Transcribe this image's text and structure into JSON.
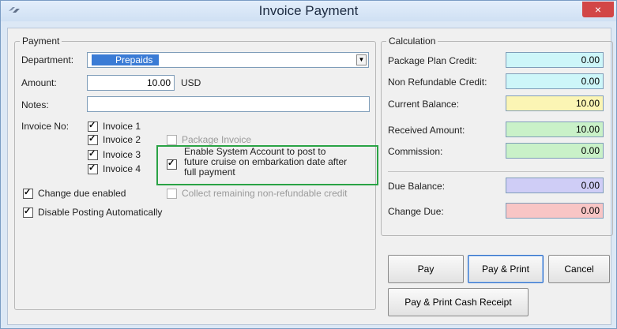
{
  "window": {
    "title": "Invoice Payment",
    "close_glyph": "×",
    "app_icon": "link-icon"
  },
  "payment": {
    "legend": "Payment",
    "department_label": "Department:",
    "department_value": "Prepaids",
    "amount_label": "Amount:",
    "amount_value": "10.00",
    "currency": "USD",
    "notes_label": "Notes:",
    "notes_value": "",
    "invoice_no_label": "Invoice No:",
    "invoices": [
      {
        "label": "Invoice 1",
        "checked": true
      },
      {
        "label": "Invoice 2",
        "checked": true
      },
      {
        "label": "Invoice 3",
        "checked": true
      },
      {
        "label": "Invoice 4",
        "checked": true
      }
    ],
    "package_invoice": {
      "label": "Package Invoice",
      "checked": false,
      "enabled": false
    },
    "enable_system_account": {
      "line1": "Enable System Account to post to",
      "line2": "future cruise on embarkation date after",
      "line3": "full payment",
      "checked": true
    },
    "collect_nonrefundable": {
      "label": "Collect remaining non-refundable credit",
      "checked": false,
      "enabled": false
    },
    "change_due_enabled": {
      "label": "Change due enabled",
      "checked": true
    },
    "disable_posting": {
      "label": "Disable Posting Automatically",
      "checked": true
    }
  },
  "calculation": {
    "legend": "Calculation",
    "rows": [
      {
        "label": "Package Plan Credit:",
        "value": "0.00",
        "color": "#cdf6f9"
      },
      {
        "label": "Non Refundable Credit:",
        "value": "0.00",
        "color": "#cdf6f9"
      },
      {
        "label": "Current Balance:",
        "value": "10.00",
        "color": "#fbf5b4"
      },
      {
        "label": "Received Amount:",
        "value": "10.00",
        "color": "#c9f1c8"
      },
      {
        "label": "Commission:",
        "value": "0.00",
        "color": "#c9f1c8"
      },
      {
        "label": "Due Balance:",
        "value": "0.00",
        "color": "#cfcdf6"
      },
      {
        "label": "Change Due:",
        "value": "0.00",
        "color": "#f8c5c5"
      }
    ]
  },
  "buttons": {
    "pay": "Pay",
    "pay_print": "Pay & Print",
    "cancel": "Cancel",
    "pay_print_cash": "Pay & Print Cash Receipt"
  }
}
